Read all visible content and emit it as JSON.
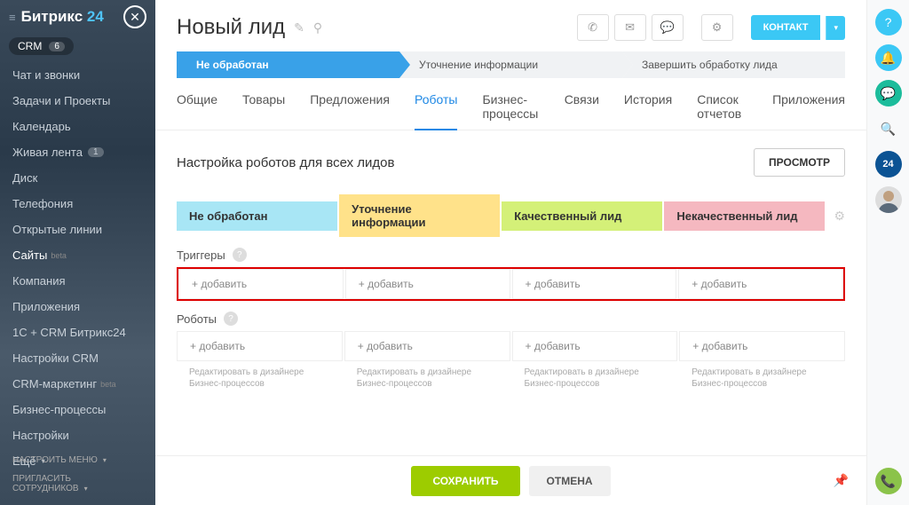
{
  "logo": {
    "brand": "Битрикс",
    "num": "24"
  },
  "crm_badge": {
    "label": "CRM",
    "count": "6"
  },
  "nav": [
    {
      "label": "Чат и звонки"
    },
    {
      "label": "Задачи и Проекты"
    },
    {
      "label": "Календарь"
    },
    {
      "label": "Живая лента",
      "badge": "1"
    },
    {
      "label": "Диск"
    },
    {
      "label": "Телефония"
    },
    {
      "label": "Открытые линии"
    },
    {
      "label": "Сайты",
      "beta": "beta"
    },
    {
      "label": "Компания"
    },
    {
      "label": "Приложения"
    },
    {
      "label": "1С + CRM Битрикс24"
    },
    {
      "label": "Настройки CRM"
    },
    {
      "label": "CRM-маркетинг",
      "beta": "beta"
    },
    {
      "label": "Бизнес-процессы"
    },
    {
      "label": "Настройки"
    },
    {
      "label": "Ещё"
    }
  ],
  "sidebar_footer": {
    "menu": "НАСТРОИТЬ МЕНЮ",
    "invite": "ПРИГЛАСИТЬ СОТРУДНИКОВ"
  },
  "page": {
    "title": "Новый лид",
    "contact_btn": "КОНТАКТ"
  },
  "stages": [
    {
      "label": "Не обработан",
      "active": true
    },
    {
      "label": "Уточнение информации"
    },
    {
      "label": "Завершить обработку лида"
    }
  ],
  "tabs": [
    {
      "label": "Общие"
    },
    {
      "label": "Товары"
    },
    {
      "label": "Предложения"
    },
    {
      "label": "Роботы",
      "active": true
    },
    {
      "label": "Бизнес-процессы"
    },
    {
      "label": "Связи"
    },
    {
      "label": "История"
    },
    {
      "label": "Список отчетов"
    },
    {
      "label": "Приложения"
    }
  ],
  "content": {
    "title": "Настройка роботов для всех лидов",
    "preview": "ПРОСМОТР",
    "statuses": [
      "Не обработан",
      "Уточнение информации",
      "Качественный лид",
      "Некачественный лид"
    ],
    "triggers_label": "Триггеры",
    "robots_label": "Роботы",
    "add_label": "+ добавить",
    "hint": "Редактировать в дизайнере Бизнес-процессов"
  },
  "footer": {
    "save": "СОХРАНИТЬ",
    "cancel": "ОТМЕНА"
  },
  "rail": {
    "b24": "24"
  }
}
